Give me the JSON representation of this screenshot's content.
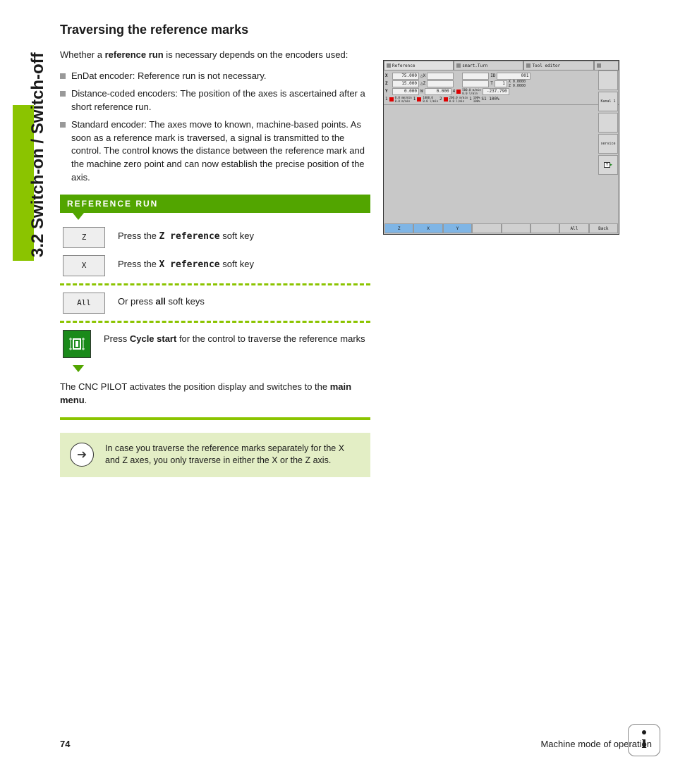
{
  "sideLabel": "3.2 Switch-on / Switch-off",
  "heading": "Traversing the reference marks",
  "intro_pre": "Whether a ",
  "intro_bold": "reference run",
  "intro_post": " is necessary depends on the encoders used:",
  "bullets": [
    "EnDat encoder: Reference run is not necessary.",
    "Distance-coded encoders: The position of the axes is ascertained after a short reference run.",
    "Standard encoder: The axes move to known, machine-based points. As soon as a reference mark is traversed, a signal is transmitted to the control. The control knows the distance between the reference mark and the machine zero point and can now establish the precise position of the axis."
  ],
  "refHeader": "REFERENCE RUN",
  "steps": {
    "z": {
      "key": "Z",
      "pre": "Press the ",
      "mono": "Z reference",
      "post": " soft key"
    },
    "x": {
      "key": "X",
      "pre": "Press the ",
      "mono": "X reference",
      "post": " soft key"
    },
    "all": {
      "key": "All",
      "pre": "Or press ",
      "bold": "all",
      "post": " soft keys"
    },
    "cycle": {
      "pre": "Press ",
      "bold": "Cycle start",
      "post": " for the control to traverse the reference marks"
    }
  },
  "para_pre": "The CNC PILOT activates the position display and switches to the ",
  "para_bold": "main menu",
  "para_post": ".",
  "note": "In case you traverse the reference marks separately for the X and Z axes, you only traverse in either the X or the Z axis.",
  "screenshot": {
    "tabs": [
      "Reference",
      "smart.Turn",
      "Tool editor",
      ""
    ],
    "rows": {
      "x": {
        "label": "X",
        "val": "75.000",
        "d": "△X",
        "id": "ID",
        "idval": "001"
      },
      "z": {
        "label": "Z",
        "val": "15.000",
        "d": "△Z",
        "t": "T",
        "tval": "1",
        "xv": "0.0000",
        "zv": "0.0000"
      },
      "y": {
        "label": "Y",
        "val": "0.000",
        "w": "W",
        "wval": "0.000",
        "n1": "4",
        "rpm": "500.0 m/min",
        "rpm2": "0.0 l/min",
        "r": "-237.790"
      },
      "s": {
        "s1": "1",
        "v1": "0.0 mm/min",
        "v1b": "0.0 m/min",
        "n2": "1",
        "v2": "1000.0",
        "v2b": "0.0 l/min",
        "n3": "2",
        "v3": "200.0 m/min",
        "v3b": "0.0 l/min",
        "n4": "1",
        "p1": "100%",
        "p2": "100%",
        "s": "S1 100%"
      }
    },
    "side": [
      "",
      "Kanal 1",
      "",
      "service",
      "T"
    ],
    "bottom": [
      "Z",
      "X",
      "Y",
      "",
      "",
      "",
      "All",
      "Back"
    ]
  },
  "footer": {
    "page": "74",
    "text": "Machine mode of operation"
  }
}
